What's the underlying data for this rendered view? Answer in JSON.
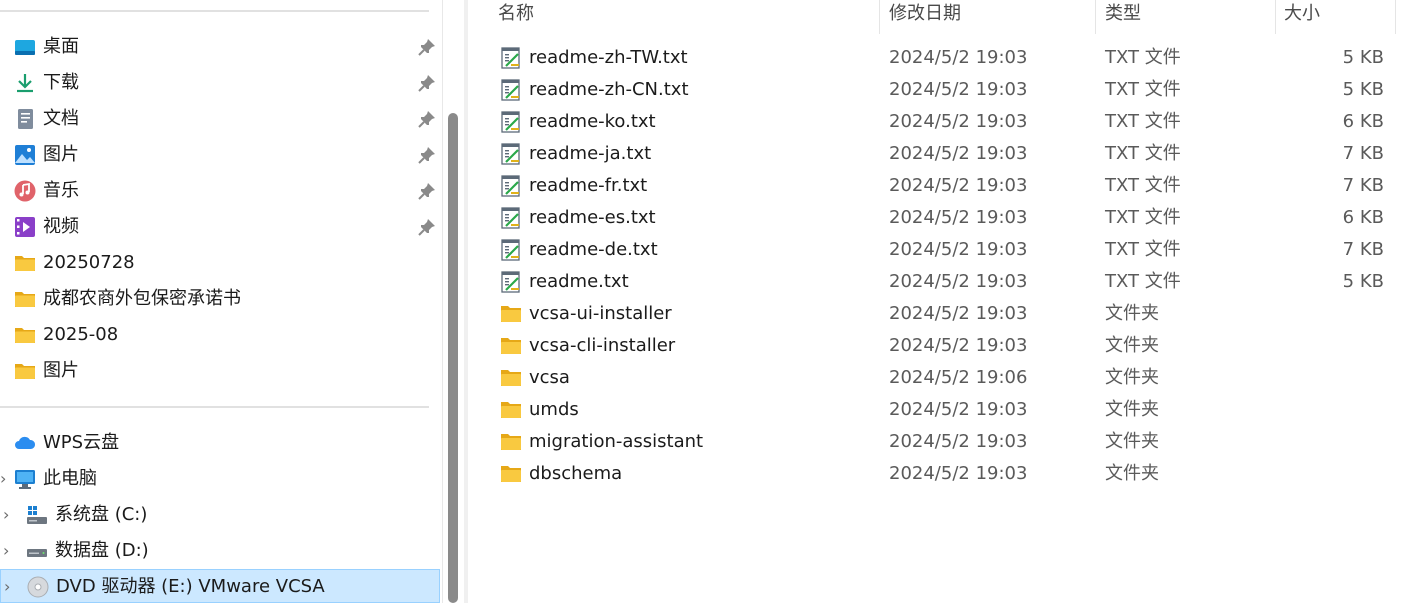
{
  "nav": {
    "quick_access": [
      {
        "label": "桌面",
        "icon": "desktop-icon",
        "pinned": true
      },
      {
        "label": "下载",
        "icon": "download-icon",
        "pinned": true
      },
      {
        "label": "文档",
        "icon": "document-icon",
        "pinned": true
      },
      {
        "label": "图片",
        "icon": "pictures-icon",
        "pinned": true
      },
      {
        "label": "音乐",
        "icon": "music-icon",
        "pinned": true
      },
      {
        "label": "视频",
        "icon": "video-icon",
        "pinned": true
      },
      {
        "label": "20250728",
        "icon": "folder-icon",
        "pinned": false
      },
      {
        "label": "成都农商外包保密承诺书",
        "icon": "folder-icon",
        "pinned": false
      },
      {
        "label": "2025-08",
        "icon": "folder-icon",
        "pinned": false
      },
      {
        "label": "图片",
        "icon": "folder-icon",
        "pinned": false
      }
    ],
    "locations": [
      {
        "label": "WPS云盘",
        "icon": "cloud-icon"
      },
      {
        "label": "此电脑",
        "icon": "computer-icon"
      }
    ],
    "drives": [
      {
        "label": "系统盘 (C:)",
        "icon": "windows-drive-icon"
      },
      {
        "label": "数据盘 (D:)",
        "icon": "drive-icon"
      },
      {
        "label": "DVD 驱动器 (E:) VMware VCSA",
        "icon": "dvd-icon",
        "selected": true
      }
    ]
  },
  "list": {
    "headers": {
      "name": "名称",
      "date": "修改日期",
      "type": "类型",
      "size": "大小"
    },
    "files": [
      {
        "name": "readme-zh-TW.txt",
        "date": "2024/5/2 19:03",
        "type": "TXT 文件",
        "size": "5 KB",
        "kind": "txt"
      },
      {
        "name": "readme-zh-CN.txt",
        "date": "2024/5/2 19:03",
        "type": "TXT 文件",
        "size": "5 KB",
        "kind": "txt"
      },
      {
        "name": "readme-ko.txt",
        "date": "2024/5/2 19:03",
        "type": "TXT 文件",
        "size": "6 KB",
        "kind": "txt"
      },
      {
        "name": "readme-ja.txt",
        "date": "2024/5/2 19:03",
        "type": "TXT 文件",
        "size": "7 KB",
        "kind": "txt"
      },
      {
        "name": "readme-fr.txt",
        "date": "2024/5/2 19:03",
        "type": "TXT 文件",
        "size": "7 KB",
        "kind": "txt"
      },
      {
        "name": "readme-es.txt",
        "date": "2024/5/2 19:03",
        "type": "TXT 文件",
        "size": "6 KB",
        "kind": "txt"
      },
      {
        "name": "readme-de.txt",
        "date": "2024/5/2 19:03",
        "type": "TXT 文件",
        "size": "7 KB",
        "kind": "txt"
      },
      {
        "name": "readme.txt",
        "date": "2024/5/2 19:03",
        "type": "TXT 文件",
        "size": "5 KB",
        "kind": "txt"
      },
      {
        "name": "vcsa-ui-installer",
        "date": "2024/5/2 19:03",
        "type": "文件夹",
        "size": "",
        "kind": "folder"
      },
      {
        "name": "vcsa-cli-installer",
        "date": "2024/5/2 19:03",
        "type": "文件夹",
        "size": "",
        "kind": "folder"
      },
      {
        "name": "vcsa",
        "date": "2024/5/2 19:06",
        "type": "文件夹",
        "size": "",
        "kind": "folder"
      },
      {
        "name": "umds",
        "date": "2024/5/2 19:03",
        "type": "文件夹",
        "size": "",
        "kind": "folder"
      },
      {
        "name": "migration-assistant",
        "date": "2024/5/2 19:03",
        "type": "文件夹",
        "size": "",
        "kind": "folder"
      },
      {
        "name": "dbschema",
        "date": "2024/5/2 19:03",
        "type": "文件夹",
        "size": "",
        "kind": "folder"
      }
    ]
  },
  "colors": {
    "selection_bg": "#cce8ff",
    "selection_border": "#99d1ff",
    "folder": "#f5c33b"
  }
}
